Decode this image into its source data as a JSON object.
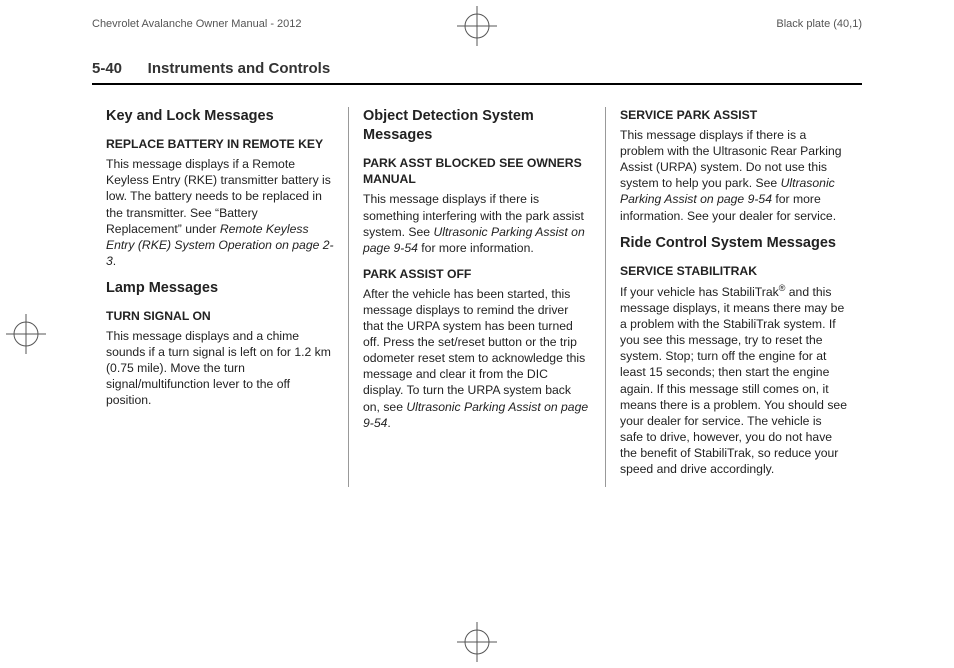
{
  "print": {
    "doc_title": "Chevrolet Avalanche Owner Manual - 2012",
    "plate": "Black plate (40,1)"
  },
  "header": {
    "page_number": "5-40",
    "section_title": "Instruments and Controls"
  },
  "col1": {
    "h1": "Key and Lock Messages",
    "m1_title": "REPLACE BATTERY IN REMOTE KEY",
    "m1_body_a": "This message displays if a Remote Keyless Entry (RKE) transmitter battery is low. The battery needs to be replaced in the transmitter. See “Battery Replacement” under ",
    "m1_ref": "Remote Keyless Entry (RKE) System Operation on page 2-3",
    "m1_body_b": ".",
    "h2": "Lamp Messages",
    "m2_title": "TURN SIGNAL ON",
    "m2_body": "This message displays and a chime sounds if a turn signal is left on for 1.2 km (0.75 mile). Move the turn signal/multifunction lever to the off position."
  },
  "col2": {
    "h1": "Object Detection System Messages",
    "m1_title": "PARK ASST BLOCKED SEE OWNERS MANUAL",
    "m1_body_a": "This message displays if there is something interfering with the park assist system. See ",
    "m1_ref": "Ultrasonic Parking Assist on page 9-54",
    "m1_body_b": " for more information.",
    "m2_title": "PARK ASSIST OFF",
    "m2_body_a": "After the vehicle has been started, this message displays to remind the driver that the URPA system has been turned off. Press the set/reset button or the trip odometer reset stem to acknowledge this message and clear it from the DIC display. To turn the URPA system back on, see ",
    "m2_ref": "Ultrasonic Parking Assist on page 9-54",
    "m2_body_b": "."
  },
  "col3": {
    "m1_title": "SERVICE PARK ASSIST",
    "m1_body_a": "This message displays if there is a problem with the Ultrasonic Rear Parking Assist (URPA) system. Do not use this system to help you park. See ",
    "m1_ref": "Ultrasonic Parking Assist on page 9-54",
    "m1_body_b": " for more information. See your dealer for service.",
    "h2": "Ride Control System Messages",
    "m2_title": "SERVICE STABILITRAK",
    "m2_body_a": "If your vehicle has StabiliTrak",
    "m2_reg": "®",
    "m2_body_b": " and this message displays, it means there may be a problem with the StabiliTrak system. If you see this message, try to reset the system. Stop; turn off the engine for at least 15 seconds; then start the engine again. If this message still comes on, it means there is a problem. You should see your dealer for service. The vehicle is safe to drive, however, you do not have the benefit of StabiliTrak, so reduce your speed and drive accordingly."
  }
}
